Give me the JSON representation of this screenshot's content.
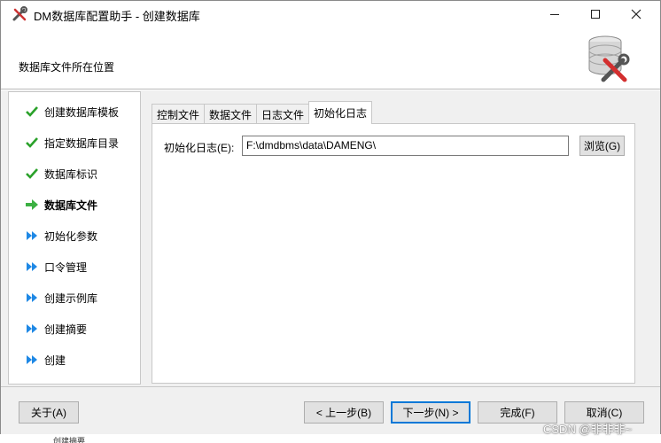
{
  "window": {
    "title": "DM数据库配置助手 - 创建数据库",
    "subtitle": "数据库文件所在位置"
  },
  "steps": [
    {
      "label": "创建数据库模板",
      "state": "done",
      "icon": "check-icon"
    },
    {
      "label": "指定数据库目录",
      "state": "done",
      "icon": "check-icon"
    },
    {
      "label": "数据库标识",
      "state": "done",
      "icon": "check-icon"
    },
    {
      "label": "数据库文件",
      "state": "current",
      "icon": "arrow-right-icon"
    },
    {
      "label": "初始化参数",
      "state": "pending",
      "icon": "double-arrow-icon"
    },
    {
      "label": "口令管理",
      "state": "pending",
      "icon": "double-arrow-icon"
    },
    {
      "label": "创建示例库",
      "state": "pending",
      "icon": "double-arrow-icon"
    },
    {
      "label": "创建摘要",
      "state": "pending",
      "icon": "double-arrow-icon"
    },
    {
      "label": "创建",
      "state": "pending",
      "icon": "double-arrow-icon"
    }
  ],
  "tabs": [
    {
      "label": "控制文件",
      "active": false
    },
    {
      "label": "数据文件",
      "active": false
    },
    {
      "label": "日志文件",
      "active": false
    },
    {
      "label": "初始化日志",
      "active": true
    }
  ],
  "panel": {
    "field_label": "初始化日志(E):",
    "path_value": "F:\\dmdbms\\data\\DAMENG\\",
    "browse_label": "浏览(G)"
  },
  "footer": {
    "about": "关于(A)",
    "prev": "< 上一步(B)",
    "next": "下一步(N) >",
    "finish": "完成(F)",
    "cancel": "取消(C)"
  },
  "background": {
    "strip_text": "创建摘要"
  },
  "watermark": "CSDN @非非非~",
  "colors": {
    "check": "#2aa12a",
    "current_arrow": "#3cb043",
    "pending_arrow": "#1e88e5",
    "default_button_border": "#0078d7"
  }
}
